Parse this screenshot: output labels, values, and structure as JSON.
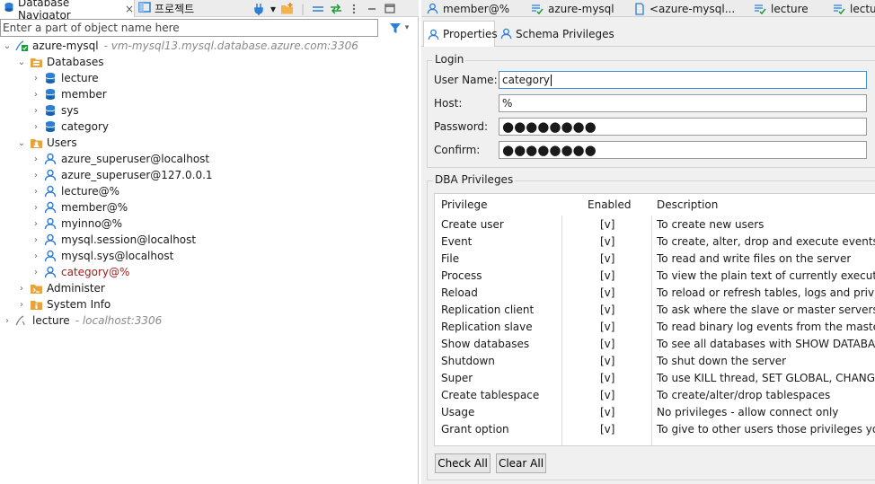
{
  "left_panel": {
    "tabs": [
      {
        "label": "Database Navigator",
        "close": "×"
      },
      {
        "label": "프로젝트"
      }
    ],
    "search": {
      "placeholder": "Enter a part of object name here",
      "value": ""
    },
    "tree": [
      {
        "label": "azure-mysql",
        "detail": "- vm-mysql13.mysql.database.azure.com:3306",
        "icon": "connection-icon",
        "expanded": true
      },
      {
        "label": "Databases",
        "icon": "databases-folder-icon",
        "expanded": true
      },
      {
        "label": "lecture",
        "icon": "database-icon"
      },
      {
        "label": "member",
        "icon": "database-icon"
      },
      {
        "label": "sys",
        "icon": "database-icon"
      },
      {
        "label": "category",
        "icon": "database-icon"
      },
      {
        "label": "Users",
        "icon": "users-folder-icon",
        "expanded": true
      },
      {
        "label": "azure_superuser@localhost",
        "icon": "user-icon"
      },
      {
        "label": "azure_superuser@127.0.0.1",
        "icon": "user-icon"
      },
      {
        "label": "lecture@%",
        "icon": "user-icon"
      },
      {
        "label": "member@%",
        "icon": "user-icon"
      },
      {
        "label": "myinno@%",
        "icon": "user-icon"
      },
      {
        "label": "mysql.session@localhost",
        "icon": "user-icon"
      },
      {
        "label": "mysql.sys@localhost",
        "icon": "user-icon"
      },
      {
        "label": "category@%",
        "icon": "user-icon",
        "modified": true
      },
      {
        "label": "Administer",
        "icon": "administer-folder-icon"
      },
      {
        "label": "System Info",
        "icon": "system-info-icon"
      },
      {
        "label": "lecture",
        "detail": "- localhost:3306",
        "icon": "connection-icon"
      }
    ]
  },
  "editor": {
    "tabs": [
      {
        "label": "member@%",
        "icon": "user-icon"
      },
      {
        "label": "azure-mysql",
        "icon": "sql-editor-icon"
      },
      {
        "label": "<azure-mysql...",
        "icon": "sql-script-icon"
      },
      {
        "label": "lecture",
        "icon": "sql-editor-icon"
      },
      {
        "label": "lectur",
        "icon": "sql-editor-icon"
      }
    ],
    "subtabs": [
      {
        "label": "Properties",
        "icon": "user-icon",
        "active": true
      },
      {
        "label": "Schema Privileges",
        "icon": "user-icon"
      }
    ],
    "login": {
      "title": "Login",
      "user_name_label": "User Name:",
      "user_name": "category",
      "host_label": "Host:",
      "host": "%",
      "password_label": "Password:",
      "password": "●●●●●●●●",
      "confirm_label": "Confirm:",
      "confirm": "●●●●●●●●"
    },
    "dba": {
      "title": "DBA Privileges",
      "columns": [
        "Privilege",
        "Enabled",
        "Description"
      ],
      "rows": [
        {
          "privilege": "Create user",
          "enabled": "[v]",
          "description": "To create new users"
        },
        {
          "privilege": "Event",
          "enabled": "[v]",
          "description": "To create, alter, drop and execute events"
        },
        {
          "privilege": "File",
          "enabled": "[v]",
          "description": "To read and write files on the server"
        },
        {
          "privilege": "Process",
          "enabled": "[v]",
          "description": "To view the plain text of currently executing q"
        },
        {
          "privilege": "Reload",
          "enabled": "[v]",
          "description": "To reload or refresh tables, logs and privileges"
        },
        {
          "privilege": "Replication client",
          "enabled": "[v]",
          "description": "To ask where the slave or master servers are"
        },
        {
          "privilege": "Replication slave",
          "enabled": "[v]",
          "description": "To read binary log events from the master"
        },
        {
          "privilege": "Show databases",
          "enabled": "[v]",
          "description": "To see all databases with SHOW DATABASES"
        },
        {
          "privilege": "Shutdown",
          "enabled": "[v]",
          "description": "To shut down the server"
        },
        {
          "privilege": "Super",
          "enabled": "[v]",
          "description": "To use KILL thread, SET GLOBAL, CHANGE MA"
        },
        {
          "privilege": "Create tablespace",
          "enabled": "[v]",
          "description": "To create/alter/drop tablespaces"
        },
        {
          "privilege": "Usage",
          "enabled": "[v]",
          "description": "No privileges - allow connect only"
        },
        {
          "privilege": "Grant option",
          "enabled": "[v]",
          "description": "To give to other users those privileges you po"
        }
      ],
      "check_all": "Check All",
      "clear_all": "Clear All"
    }
  },
  "colors": {
    "accent": "#1f6fb5",
    "focus": "#3f8ed8",
    "modified": "#9b1c1c",
    "folder": "#e8a33a"
  }
}
